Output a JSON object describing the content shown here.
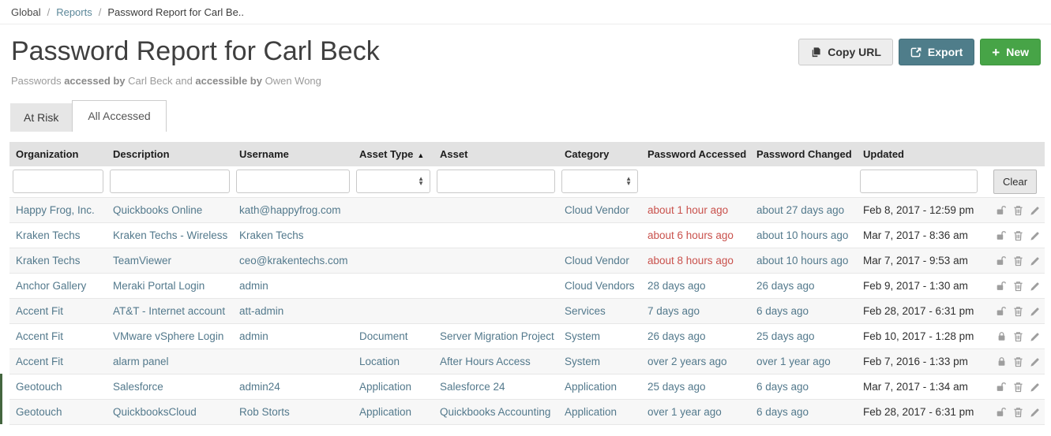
{
  "colors": {
    "row_text": "#53798c",
    "alert_text": "#c9514c",
    "highlight_bar": "#44663f",
    "export_button_bg": "#4f7d8a",
    "new_button_bg": "#47a447",
    "copy_button_bg": "#ededed"
  },
  "breadcrumb": {
    "separator": "/",
    "items": [
      {
        "label": "Global",
        "link": true
      },
      {
        "label": "Reports",
        "link": true
      },
      {
        "label": "Password Report for Carl Be..",
        "link": false
      }
    ]
  },
  "header": {
    "title": "Password Report for Carl Beck",
    "buttons": {
      "copy_url": "Copy URL",
      "export": "Export",
      "new": "New"
    }
  },
  "subtitle": {
    "parts": [
      {
        "text": "Passwords ",
        "bold": false
      },
      {
        "text": "accessed by",
        "bold": true
      },
      {
        "text": " Carl Beck and ",
        "bold": false
      },
      {
        "text": "accessible by",
        "bold": true
      },
      {
        "text": " Owen Wong",
        "bold": false
      }
    ]
  },
  "tabs": [
    {
      "label": "At Risk",
      "active": false
    },
    {
      "label": "All Accessed",
      "active": true
    }
  ],
  "table": {
    "clear_button": "Clear",
    "columns": [
      {
        "key": "org",
        "label": "Organization",
        "filter": "text"
      },
      {
        "key": "desc",
        "label": "Description",
        "filter": "text"
      },
      {
        "key": "user",
        "label": "Username",
        "filter": "text"
      },
      {
        "key": "atype",
        "label": "Asset Type",
        "filter": "select",
        "sorted": "asc"
      },
      {
        "key": "asset",
        "label": "Asset",
        "filter": "text"
      },
      {
        "key": "cat",
        "label": "Category",
        "filter": "select"
      },
      {
        "key": "accessed",
        "label": "Password Accessed",
        "filter": "none"
      },
      {
        "key": "changed",
        "label": "Password Changed",
        "filter": "none"
      },
      {
        "key": "updated",
        "label": "Updated",
        "filter": "text"
      },
      {
        "key": "actions",
        "label": "",
        "filter": "clear"
      }
    ],
    "rows": [
      {
        "org": "Happy Frog, Inc.",
        "desc": "Quickbooks Online",
        "user": "kath@happyfrog.com",
        "atype": "",
        "asset": "",
        "cat": "Cloud Vendor",
        "accessed": "about 1 hour ago",
        "accessed_alert": true,
        "changed": "about 27 days ago",
        "updated": "Feb 8, 2017 - 12:59 pm",
        "locked": false,
        "highlight": false
      },
      {
        "org": "Kraken Techs",
        "desc": "Kraken Techs - Wireless",
        "user": "Kraken Techs",
        "atype": "",
        "asset": "",
        "cat": "",
        "accessed": "about 6 hours ago",
        "accessed_alert": true,
        "changed": "about 10 hours ago",
        "updated": "Mar 7, 2017 - 8:36 am",
        "locked": false,
        "highlight": false
      },
      {
        "org": "Kraken Techs",
        "desc": "TeamViewer",
        "user": "ceo@krakentechs.com",
        "atype": "",
        "asset": "",
        "cat": "Cloud Vendor",
        "accessed": "about 8 hours ago",
        "accessed_alert": true,
        "changed": "about 10 hours ago",
        "updated": "Mar 7, 2017 - 9:53 am",
        "locked": false,
        "highlight": false
      },
      {
        "org": "Anchor Gallery",
        "desc": "Meraki Portal Login",
        "user": "admin",
        "atype": "",
        "asset": "",
        "cat": "Cloud Vendors",
        "accessed": "28 days ago",
        "accessed_alert": false,
        "changed": "26 days ago",
        "updated": "Feb 9, 2017 - 1:30 am",
        "locked": false,
        "highlight": false
      },
      {
        "org": "Accent Fit",
        "desc": "AT&T - Internet account",
        "user": "att-admin",
        "atype": "",
        "asset": "",
        "cat": "Services",
        "accessed": "7 days ago",
        "accessed_alert": false,
        "changed": "6 days ago",
        "updated": "Feb 28, 2017 - 6:31 pm",
        "locked": false,
        "highlight": false
      },
      {
        "org": "Accent Fit",
        "desc": "VMware vSphere Login",
        "user": "admin",
        "atype": "Document",
        "asset": "Server Migration Project",
        "cat": "System",
        "accessed": "26 days ago",
        "accessed_alert": false,
        "changed": "25 days ago",
        "updated": "Feb 10, 2017 - 1:28 pm",
        "locked": true,
        "highlight": false
      },
      {
        "org": "Accent Fit",
        "desc": "alarm panel",
        "user": "",
        "atype": "Location",
        "asset": "After Hours Access",
        "cat": "System",
        "accessed": "over 2 years ago",
        "accessed_alert": false,
        "changed": "over 1 year ago",
        "updated": "Feb 7, 2016 - 1:33 pm",
        "locked": true,
        "highlight": false
      },
      {
        "org": "Geotouch",
        "desc": "Salesforce",
        "user": "admin24",
        "atype": "Application",
        "asset": "Salesforce 24",
        "cat": "Application",
        "accessed": "25 days ago",
        "accessed_alert": false,
        "changed": "6 days ago",
        "updated": "Mar 7, 2017 - 1:34 am",
        "locked": false,
        "highlight": true
      },
      {
        "org": "Geotouch",
        "desc": "QuickbooksCloud",
        "user": "Rob Storts",
        "atype": "Application",
        "asset": "Quickbooks Accounting",
        "cat": "Application",
        "accessed": "over 1 year ago",
        "accessed_alert": false,
        "changed": "6 days ago",
        "updated": "Feb 28, 2017 - 6:31 pm",
        "locked": false,
        "highlight": true
      }
    ]
  }
}
